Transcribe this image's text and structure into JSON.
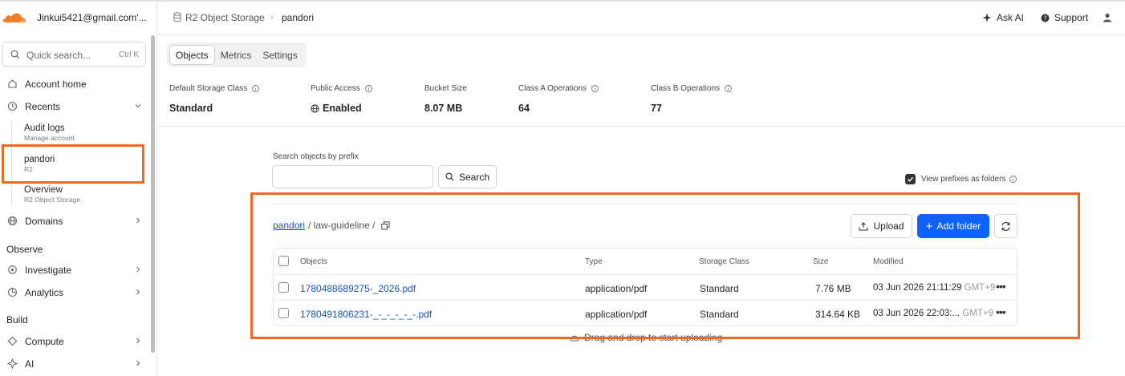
{
  "colors": {
    "accent": "#0f62f9",
    "highlight": "#f26722",
    "brand": "#f38020"
  },
  "account": {
    "email": "Jinkui5421@gmail.com'..."
  },
  "sidebar": {
    "search_placeholder": "Quick search...",
    "search_shortcut": "Ctrl K",
    "account_home": "Account home",
    "recents": "Recents",
    "recent_items": [
      {
        "title": "Audit logs",
        "subtitle": "Manage account"
      },
      {
        "title": "pandori",
        "subtitle": "R2"
      },
      {
        "title": "Overview",
        "subtitle": "R2 Object Storage"
      }
    ],
    "domains": "Domains",
    "observe_heading": "Observe",
    "investigate": "Investigate",
    "analytics": "Analytics",
    "build_heading": "Build",
    "compute": "Compute",
    "ai": "AI"
  },
  "header": {
    "breadcrumb_service": "R2 Object Storage",
    "breadcrumb_bucket": "pandori",
    "ask_ai": "Ask AI",
    "support": "Support"
  },
  "tabs": [
    "Objects",
    "Metrics",
    "Settings"
  ],
  "stats": [
    {
      "label": "Default Storage Class",
      "value": "Standard"
    },
    {
      "label": "Public Access",
      "value": "Enabled"
    },
    {
      "label": "Bucket Size",
      "value": "8.07 MB"
    },
    {
      "label": "Class A Operations",
      "value": "64"
    },
    {
      "label": "Class B Operations",
      "value": "77"
    }
  ],
  "prefix_search": {
    "label": "Search objects by prefix",
    "value": "",
    "button": "Search",
    "view_prefixes_label": "View prefixes as folders",
    "view_prefixes_checked": true
  },
  "path": {
    "root": "pandori",
    "rest": "/ law-guideline /"
  },
  "actions": {
    "upload": "Upload",
    "add_folder": "Add folder"
  },
  "table": {
    "columns": [
      "Objects",
      "Type",
      "Storage Class",
      "Size",
      "Modified"
    ],
    "rows": [
      {
        "name": "1780488689275-_2026.pdf",
        "type": "application/pdf",
        "storage": "Standard",
        "size": "7.76 MB",
        "modified": "03 Jun 2026 21:11:29",
        "tz": "GMT+9"
      },
      {
        "name": "1780491806231-_-_-_-_-_-.pdf",
        "type": "application/pdf",
        "storage": "Standard",
        "size": "314.64 KB",
        "modified": "03 Jun 2026 22:03:...",
        "tz": "GMT+9"
      }
    ]
  },
  "drop_hint": "Drag and drop to start uploading"
}
